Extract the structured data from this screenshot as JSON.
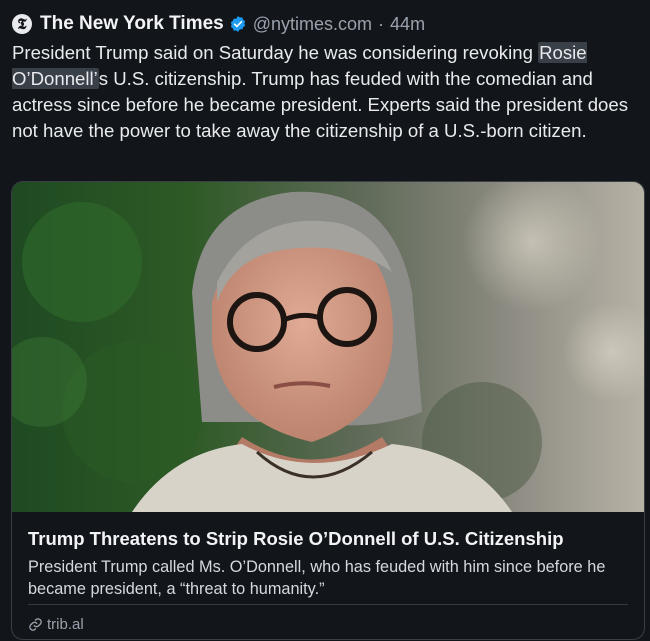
{
  "post": {
    "author_name": "The New York Times",
    "handle": "@nytimes.com",
    "separator": "·",
    "time_ago": "44m",
    "logo_glyph": "𝕿",
    "text_before": "President Trump said on Saturday he was considering revoking ",
    "text_highlight": "Rosie O’Donnell’",
    "text_after": "s U.S. citizenship. Trump has feuded with the comedian and actress since before he became president. Experts said the president does not have the power to take away the citizenship of a U.S.-born citizen.",
    "icons": {
      "logo": "nyt-logo-icon",
      "verified": "verified-badge-icon",
      "link": "link-icon"
    },
    "colors": {
      "background": "#12161b",
      "verified": "#1d9bf0",
      "muted": "#9aa1ab"
    }
  },
  "card": {
    "title": "Trump Threatens to Strip Rosie O’Donnell of U.S. Citizenship",
    "description": "President Trump called Ms. O’Donnell, who has feuded with him since before he became president, a “threat to humanity.”",
    "domain": "trib.al"
  }
}
